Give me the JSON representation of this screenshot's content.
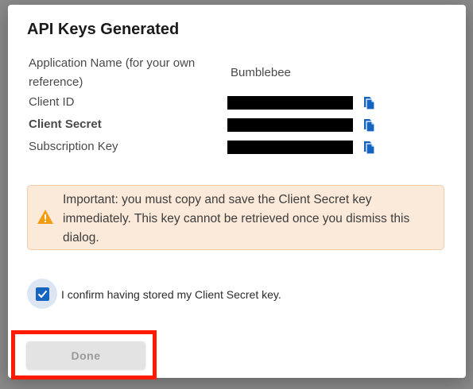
{
  "dialog": {
    "title": "API Keys Generated"
  },
  "keys": {
    "app_name_label": "Application Name (for your own reference)",
    "app_name_value": "Bumblebee",
    "client_id_label": "Client ID",
    "client_secret_label": "Client Secret",
    "subscription_key_label": "Subscription Key"
  },
  "warning": {
    "text": "Important: you must copy and save the Client Secret key immediately. This key cannot be retrieved once you dismiss this dialog.",
    "icon": "warning-triangle-icon",
    "color": "#f39c12"
  },
  "confirm": {
    "checked": true,
    "label": "I confirm having stored my Client Secret key."
  },
  "actions": {
    "done_label": "Done",
    "done_disabled": true
  },
  "colors": {
    "accent": "#1565c0",
    "warning_bg": "#fbe9d9",
    "highlight": "#ff1a00"
  }
}
